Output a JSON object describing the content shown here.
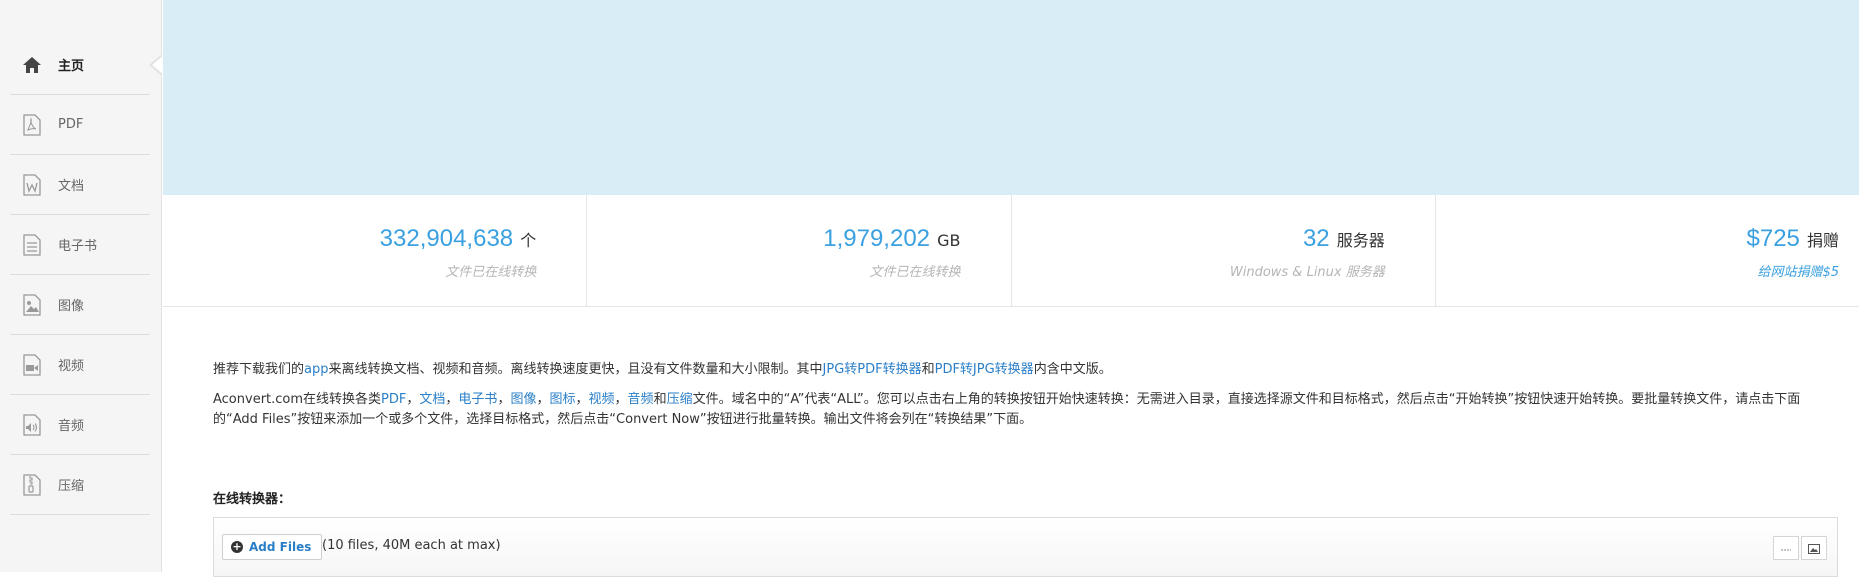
{
  "sidebar": {
    "items": [
      {
        "label": "主页",
        "icon": "home-icon",
        "active": true
      },
      {
        "label": "PDF",
        "icon": "pdf-file-icon"
      },
      {
        "label": "文档",
        "icon": "word-file-icon"
      },
      {
        "label": "电子书",
        "icon": "ebook-file-icon"
      },
      {
        "label": "图像",
        "icon": "image-file-icon"
      },
      {
        "label": "视频",
        "icon": "video-file-icon"
      },
      {
        "label": "音频",
        "icon": "audio-file-icon"
      },
      {
        "label": "压缩",
        "icon": "archive-file-icon"
      }
    ]
  },
  "stats": [
    {
      "number": "332,904,638",
      "unit": "个",
      "sub": "文件已在线转换"
    },
    {
      "number": "1,979,202",
      "unit": "GB",
      "sub": "文件已在线转换"
    },
    {
      "number": "32",
      "unit": "服务器",
      "sub": "Windows & Linux 服务器"
    },
    {
      "number": "$725",
      "unit": "捐赠",
      "sub": "给网站捐赠$5"
    }
  ],
  "intro": {
    "p1_a": "推荐下载我们的",
    "p1_link_app": "app",
    "p1_b": "来离线转换文档、视频和音频。离线转换速度更快，且没有文件数量和大小限制。其中",
    "p1_link_jpg2pdf": "JPG转PDF转换器",
    "p1_c": "和",
    "p1_link_pdf2jpg": "PDF转JPG转换器",
    "p1_d": "内含中文版。",
    "p2_a": "Aconvert.com在线转换各类",
    "p2_links": [
      "PDF",
      "文档",
      "电子书",
      "图像",
      "图标",
      "视频",
      "音频"
    ],
    "p2_sep": "，",
    "p2_and": "和",
    "p2_link_archive": "压缩",
    "p2_b": "文件。域名中的“A”代表“ALL”。您可以点击右上角的转换按钮开始快速转换：无需进入目录，直接选择源文件和目标格式，然后点击“开始转换”按钮快速开始转换。要批量转换文件，请点击下面的“Add Files”按钮来添加一个或多个文件，选择目标格式，然后点击“Convert Now”按钮进行批量转换。输出文件将会列在“转换结果”下面。"
  },
  "converter": {
    "title": "在线转换器：",
    "add_files_label": "Add Files",
    "limit_note": "(10 files, 40M each at max)"
  },
  "colors": {
    "accent": "#3aa0e0",
    "link": "#2a7fc8",
    "banner": "#d9edf7",
    "sidebar": "#f5f5f5"
  }
}
